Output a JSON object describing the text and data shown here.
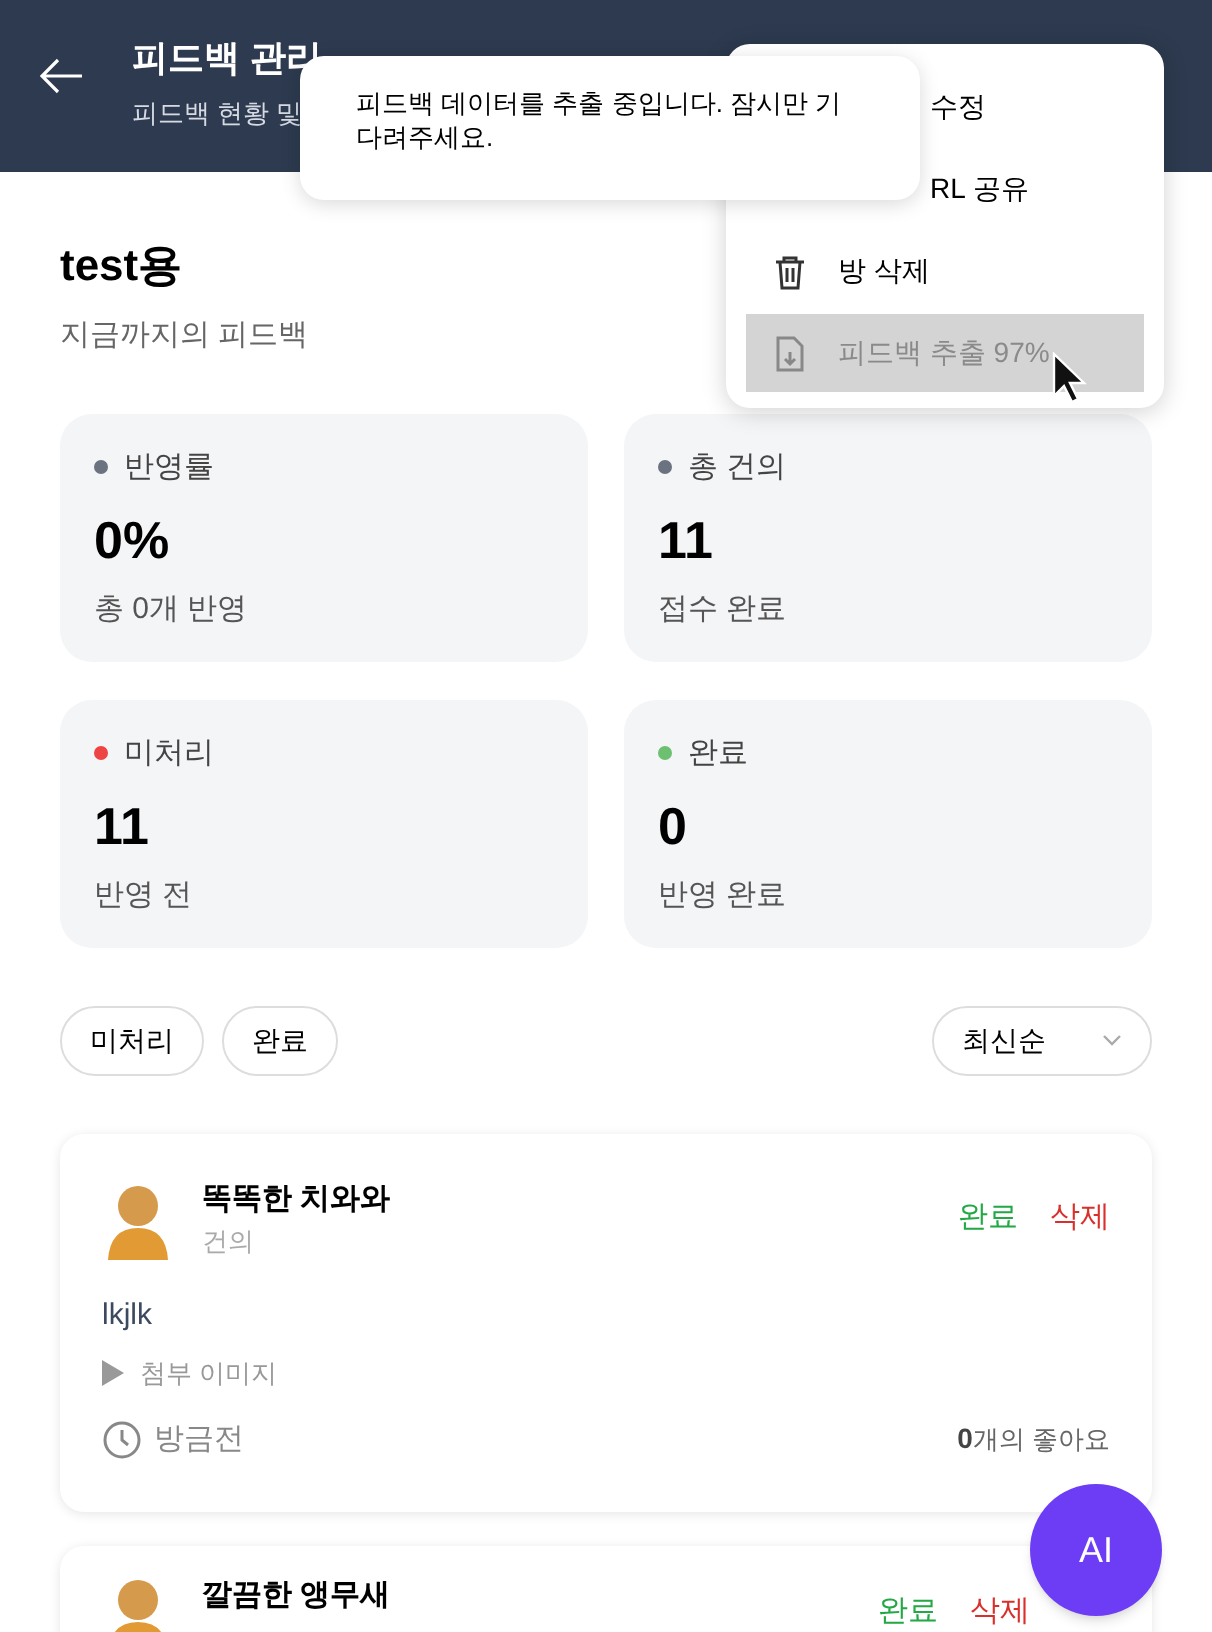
{
  "header": {
    "title": "피드백 관리",
    "subtitle": "피드백 현황 및"
  },
  "toast": {
    "message": "피드백 데이터를 추출 중입니다. 잠시만 기다려주세요."
  },
  "menu": {
    "items": [
      {
        "label": "수정",
        "kind": "covered",
        "selected": false
      },
      {
        "label": "RL 공유",
        "kind": "covered",
        "selected": false
      },
      {
        "label": "방 삭제",
        "kind": "trash",
        "selected": false
      },
      {
        "label": "피드백 추출 97%",
        "kind": "file",
        "selected": true
      }
    ]
  },
  "room": {
    "title": "test용",
    "subtitle": "지금까지의 피드백"
  },
  "stats": [
    {
      "label": "반영률",
      "color": "#6b7280",
      "value": "0%",
      "caption": "총 0개 반영"
    },
    {
      "label": "총 건의",
      "color": "#6b7280",
      "value": "11",
      "caption": "접수 완료"
    },
    {
      "label": "미처리",
      "color": "#ef4444",
      "value": "11",
      "caption": "반영 전"
    },
    {
      "label": "완료",
      "color": "#6cc070",
      "value": "0",
      "caption": "반영 완료"
    }
  ],
  "filters": [
    {
      "label": "미처리",
      "selected": false
    },
    {
      "label": "완료",
      "selected": false
    }
  ],
  "sort": {
    "value": "최신순"
  },
  "feedback": [
    {
      "author": "똑똑한 치와와",
      "type": "건의",
      "body": "lkjlk",
      "attachment": "첨부 이미지",
      "time": "방금전",
      "likes_count": "0",
      "likes_text": "개의 좋아요",
      "complete": "완료",
      "delete": "삭제"
    },
    {
      "author": "깔끔한 앵무새",
      "complete": "완료",
      "delete": "삭제"
    }
  ],
  "ai_button": {
    "label": "AI"
  }
}
